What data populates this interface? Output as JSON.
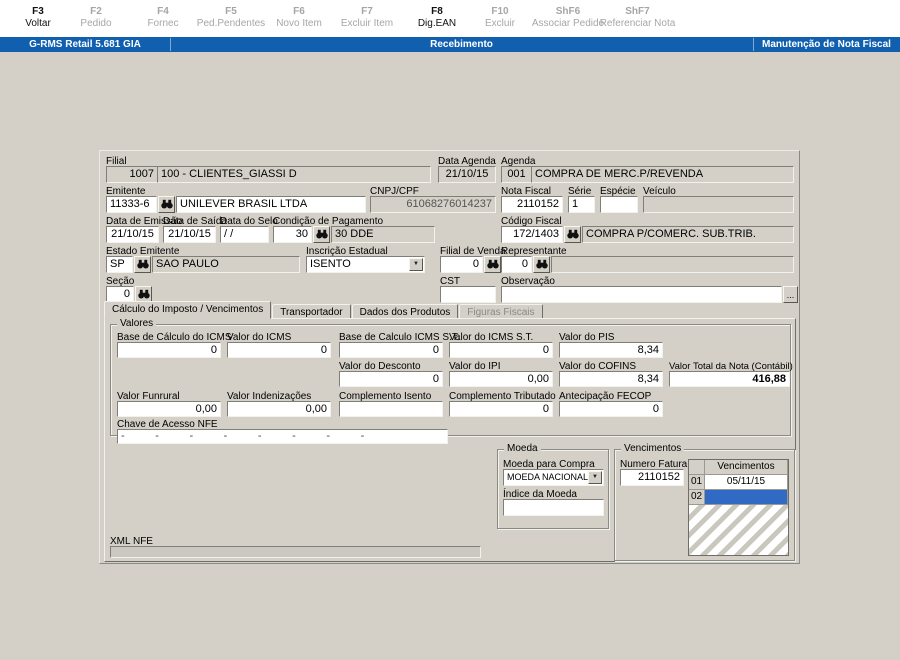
{
  "colors": {
    "window_bg": "#d4d0c8",
    "titlebar_blue": "#1160b0",
    "selection_blue": "#316ac5",
    "field_white": "#ffffff"
  },
  "function_keys": [
    {
      "key": "F3",
      "label": "Voltar",
      "enabled": true
    },
    {
      "key": "F2",
      "label": "Pedido",
      "enabled": false
    },
    {
      "key": "F4",
      "label": "Fornec",
      "enabled": false
    },
    {
      "key": "F5",
      "label": "Ped.Pendentes",
      "enabled": false
    },
    {
      "key": "F6",
      "label": "Novo Item",
      "enabled": false
    },
    {
      "key": "F7",
      "label": "Excluir Item",
      "enabled": false
    },
    {
      "key": "F8",
      "label": "Dig.EAN",
      "enabled": true
    },
    {
      "key": "F10",
      "label": "Excluir",
      "enabled": false
    },
    {
      "key": "ShF6",
      "label": "Associar Pedido",
      "enabled": false
    },
    {
      "key": "ShF7",
      "label": "Referenciar Nota",
      "enabled": false
    }
  ],
  "titlebar": {
    "app": "G-RMS Retail 5.681 GIA",
    "screen": "Recebimento",
    "task": "Manutenção de Nota Fiscal"
  },
  "icons": {
    "dropdown_arrow": "▼"
  },
  "header": {
    "filial": {
      "label": "Filial",
      "code": "1007",
      "name": "100 - CLIENTES_GIASSI D"
    },
    "data_agenda": {
      "label": "Data Agenda",
      "value": "21/10/15"
    },
    "agenda": {
      "label": "Agenda",
      "code": "001",
      "name": "COMPRA DE MERC.P/REVENDA"
    },
    "emitente": {
      "label": "Emitente",
      "code": "11333-6",
      "name": "UNILEVER BRASIL LTDA"
    },
    "cnpj_cpf": {
      "label": "CNPJ/CPF",
      "value": "61068276014237"
    },
    "nota_fiscal": {
      "label": "Nota Fiscal",
      "value": "2110152"
    },
    "serie": {
      "label": "Série",
      "value": "1"
    },
    "especie": {
      "label": "Espécie",
      "value": ""
    },
    "veiculo": {
      "label": "Veículo",
      "value": ""
    },
    "data_emissao": {
      "label": "Data de Emissão",
      "value": "21/10/15"
    },
    "data_saida": {
      "label": "Data de Saída",
      "value": "21/10/15"
    },
    "data_selo": {
      "label": "Data do Selo",
      "value": "/ /"
    },
    "condicao_pagamento": {
      "label": "Condição de Pagamento",
      "code": "30",
      "name": "30 DDE"
    },
    "codigo_fiscal": {
      "label": "Código Fiscal",
      "code": "172/1403",
      "name": "COMPRA P/COMERC. SUB.TRIB."
    },
    "estado_emitente": {
      "label": "Estado Emitente",
      "code": "SP",
      "name": "SAO PAULO"
    },
    "inscricao_estadual": {
      "label": "Inscrição Estadual",
      "value": "ISENTO"
    },
    "filial_venda": {
      "label": "Filial de Venda",
      "value": "0"
    },
    "representante": {
      "label": "Representante",
      "code": "0",
      "name": ""
    },
    "secao": {
      "label": "Seção",
      "value": "0"
    },
    "cst": {
      "label": "CST",
      "value": ""
    },
    "observacao": {
      "label": "Observação",
      "value": "",
      "more_button": "..."
    }
  },
  "tabs": [
    {
      "label": "Cálculo do Imposto / Vencimentos",
      "state": "active"
    },
    {
      "label": "Transportador",
      "state": "normal"
    },
    {
      "label": "Dados dos Produtos",
      "state": "normal"
    },
    {
      "label": "Figuras Fiscais",
      "state": "disabled"
    }
  ],
  "valores": {
    "title": "Valores",
    "base_icms": {
      "label": "Base de Cálculo do ICMS",
      "value": "0"
    },
    "valor_icms": {
      "label": "Valor do ICMS",
      "value": "0"
    },
    "base_icms_st": {
      "label": "Base de Calculo ICMS S.T.",
      "value": "0"
    },
    "valor_icms_st": {
      "label": "Valor do ICMS S.T.",
      "value": "0"
    },
    "valor_pis": {
      "label": "Valor do PIS",
      "value": "8,34"
    },
    "valor_desconto": {
      "label": "Valor do Desconto",
      "value": "0"
    },
    "valor_ipi": {
      "label": "Valor do IPI",
      "value": "0,00"
    },
    "valor_cofins": {
      "label": "Valor do COFINS",
      "value": "8,34"
    },
    "valor_total": {
      "label": "Valor Total da Nota (Contábil)",
      "value": "416,88"
    },
    "valor_funrural": {
      "label": "Valor Funrural",
      "value": "0,00"
    },
    "valor_indenizacoes": {
      "label": "Valor Indenizações",
      "value": "0,00"
    },
    "complemento_isento": {
      "label": "Complemento Isento",
      "value": ""
    },
    "complemento_tributado": {
      "label": "Complemento Tributado",
      "value": "0"
    },
    "antecipacao_fecop": {
      "label": "Antecipação FECOP",
      "value": "0"
    },
    "chave_nfe": {
      "label": "Chave de Acesso NFE",
      "value": "-          -          -          -          -          -          -          -"
    }
  },
  "moeda": {
    "title": "Moeda",
    "moeda_compra": {
      "label": "Moeda para Compra",
      "value": "MOEDA NACIONAL"
    },
    "indice_moeda": {
      "label": "Índice da Moeda",
      "value": ""
    }
  },
  "vencimentos": {
    "title": "Vencimentos",
    "numero_fatura": {
      "label": "Numero Fatura",
      "value": "2110152"
    },
    "table": {
      "header": "Vencimentos",
      "rows": [
        {
          "num": "01",
          "date": "05/11/15",
          "selected": false
        },
        {
          "num": "02",
          "date": "",
          "selected": true
        }
      ]
    }
  },
  "xml_nfe": {
    "label": "XML NFE"
  }
}
